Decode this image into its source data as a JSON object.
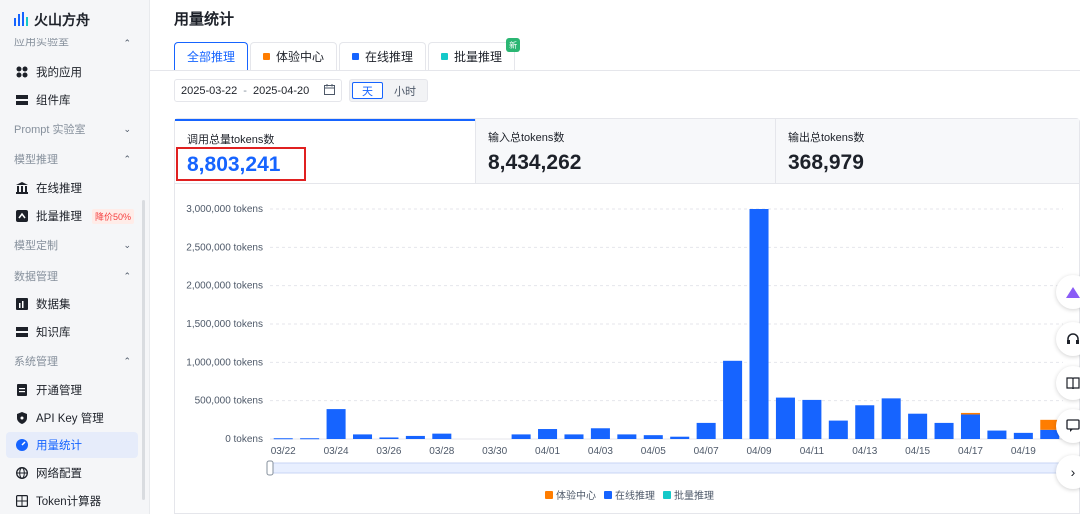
{
  "app": {
    "logo_text": "火山方舟",
    "page_title": "用量统计"
  },
  "sidebar": {
    "top_section": "应用实验室",
    "items": [
      {
        "label": "我的应用",
        "icon": "apps-icon"
      },
      {
        "label": "组件库",
        "icon": "component-icon"
      }
    ],
    "sections": [
      {
        "label": "Prompt 实验室",
        "collapsed": true
      },
      {
        "label": "模型推理",
        "collapsed": false
      },
      {
        "label": "模型定制",
        "collapsed": true
      },
      {
        "label": "数据管理",
        "collapsed": false
      },
      {
        "label": "系统管理",
        "collapsed": false
      }
    ],
    "inference_items": [
      {
        "label": "在线推理"
      },
      {
        "label": "批量推理",
        "badge": "降价50%"
      }
    ],
    "data_items": [
      {
        "label": "数据集"
      },
      {
        "label": "知识库"
      }
    ],
    "system_items": [
      {
        "label": "开通管理"
      },
      {
        "label": "API Key 管理"
      },
      {
        "label": "用量统计",
        "active": true
      },
      {
        "label": "网络配置"
      },
      {
        "label": "Token计算器"
      }
    ]
  },
  "tabs": [
    {
      "label": "全部推理",
      "active": true
    },
    {
      "label": "体验中心",
      "color": "#ff7d00"
    },
    {
      "label": "在线推理",
      "color": "#1664ff"
    },
    {
      "label": "批量推理",
      "color": "#14c9c9",
      "new_badge": "新"
    }
  ],
  "filters": {
    "start_date": "2025-03-22",
    "separator": "-",
    "end_date": "2025-04-20",
    "granularity": [
      "天",
      "小时"
    ],
    "granularity_selected": "天"
  },
  "stats": [
    {
      "label": "调用总量tokens数",
      "value": "8,803,241"
    },
    {
      "label": "输入总tokens数",
      "value": "8,434,262"
    },
    {
      "label": "输出总tokens数",
      "value": "368,979"
    }
  ],
  "chart_data": {
    "type": "bar",
    "stacked": true,
    "ylim": [
      0,
      3000000
    ],
    "yticks": [
      "3,000,000 tokens",
      "2,500,000 tokens",
      "2,000,000 tokens",
      "1,500,000 tokens",
      "1,000,000 tokens",
      "500,000 tokens",
      "0 tokens"
    ],
    "x_labels": [
      "03/22",
      "03/24",
      "03/26",
      "03/28",
      "03/30",
      "04/01",
      "04/03",
      "04/05",
      "04/07",
      "04/09",
      "04/11",
      "04/13",
      "04/15",
      "04/17",
      "04/19"
    ],
    "categories": [
      "03/22",
      "03/23",
      "03/24",
      "03/25",
      "03/26",
      "03/27",
      "03/28",
      "03/29",
      "03/30",
      "03/31",
      "04/01",
      "04/02",
      "04/03",
      "04/04",
      "04/05",
      "04/06",
      "04/07",
      "04/08",
      "04/09",
      "04/10",
      "04/11",
      "04/12",
      "04/13",
      "04/14",
      "04/15",
      "04/16",
      "04/17",
      "04/18",
      "04/19",
      "04/20"
    ],
    "series": [
      {
        "name": "体验中心",
        "color": "#ff7d00",
        "values": [
          0,
          0,
          0,
          0,
          0,
          0,
          0,
          0,
          0,
          0,
          0,
          0,
          0,
          0,
          0,
          0,
          0,
          0,
          0,
          0,
          0,
          0,
          0,
          0,
          0,
          0,
          20000,
          0,
          0,
          130000
        ]
      },
      {
        "name": "在线推理",
        "color": "#1664ff",
        "values": [
          10000,
          10000,
          390000,
          60000,
          20000,
          40000,
          70000,
          0,
          0,
          60000,
          130000,
          60000,
          140000,
          60000,
          50000,
          30000,
          210000,
          1020000,
          3000000,
          540000,
          510000,
          240000,
          440000,
          530000,
          330000,
          210000,
          320000,
          110000,
          80000,
          120000
        ]
      },
      {
        "name": "批量推理",
        "color": "#14c9c9",
        "values": [
          0,
          0,
          0,
          0,
          0,
          0,
          0,
          0,
          0,
          0,
          0,
          0,
          0,
          0,
          0,
          0,
          0,
          0,
          0,
          0,
          0,
          0,
          0,
          0,
          0,
          0,
          0,
          0,
          0,
          0
        ]
      }
    ]
  }
}
